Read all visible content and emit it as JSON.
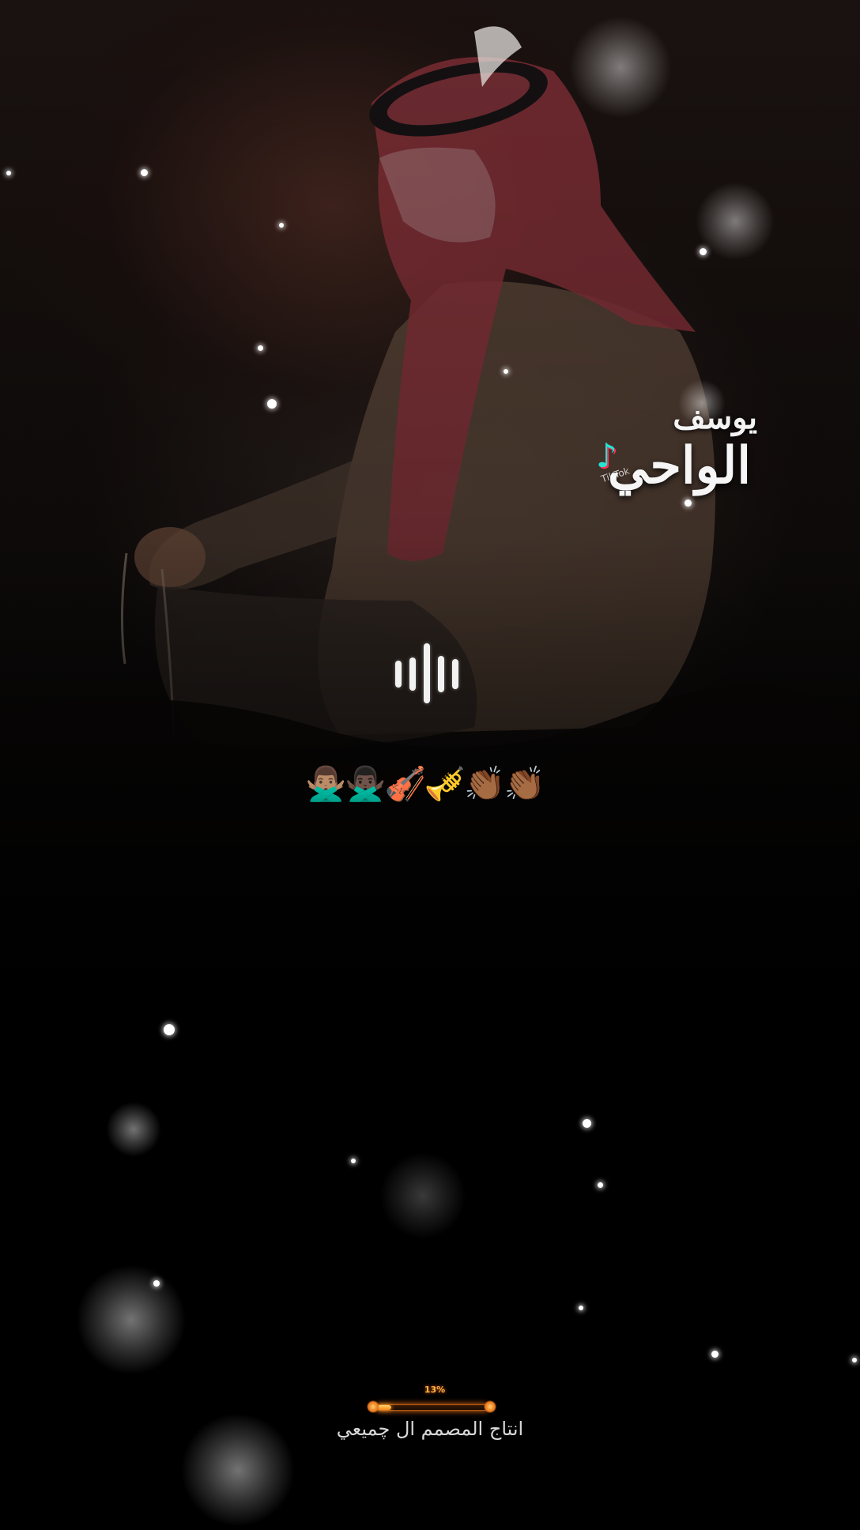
{
  "logo": {
    "name_line1": "يوسف",
    "name_line2": "الواحي",
    "tiktok_watermark": "TikTok"
  },
  "audio_indicator": {
    "icon": "audio-waveform-icon"
  },
  "emojis": "🙅🏽‍♂️🙅🏿‍♂️🎻🎺👏🏾👏🏾",
  "progress": {
    "label": "13%",
    "value": 0.13
  },
  "credit": "انتاج المصمم ال چميعي",
  "colors": {
    "background": "#050505",
    "progress_accent": "#ff8a1a",
    "logo_accent": "#27e3d3"
  }
}
